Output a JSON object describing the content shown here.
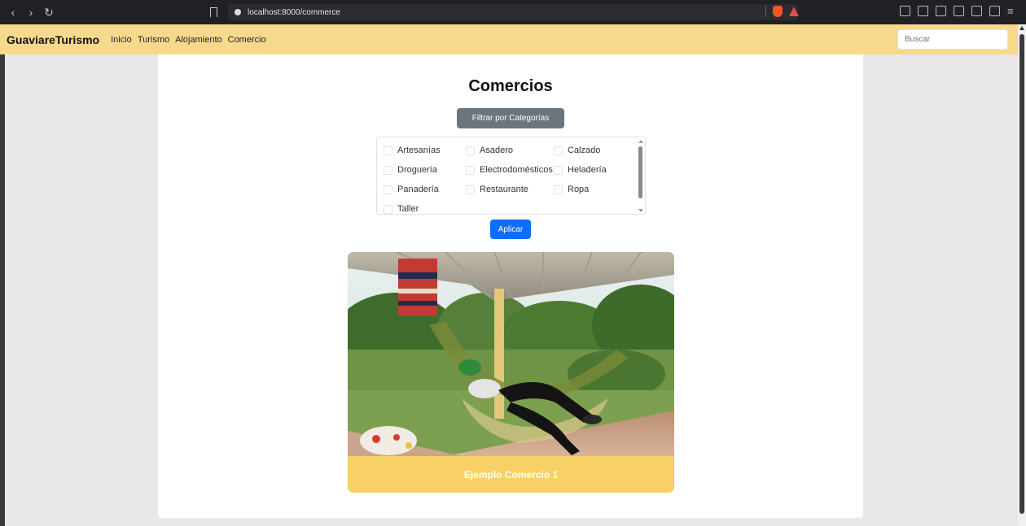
{
  "browser": {
    "url": "localhost:8000/commerce",
    "back": "‹",
    "forward": "›",
    "reload": "↻",
    "menu": "≡"
  },
  "navbar": {
    "brand": "GuaviareTurismo",
    "links": [
      "Inicio",
      "Turismo",
      "Alojamiento",
      "Comercio"
    ],
    "search_placeholder": "Buscar"
  },
  "page": {
    "title": "Comercios",
    "filter_button": "Filtrar por Categorías",
    "categories": [
      "Artesanías",
      "Asadero",
      "Calzado",
      "Droguería",
      "Electrodomésticos",
      "Heladería",
      "Panadería",
      "Restaurante",
      "Ropa",
      "Taller"
    ],
    "apply_button": "Aplicar"
  },
  "cards": [
    {
      "title": "Ejemplo Comercio 1"
    }
  ],
  "colors": {
    "navbar": "#f6d98c",
    "card_footer": "#f7d166",
    "primary": "#0d6efd",
    "secondary": "#6c757d"
  }
}
